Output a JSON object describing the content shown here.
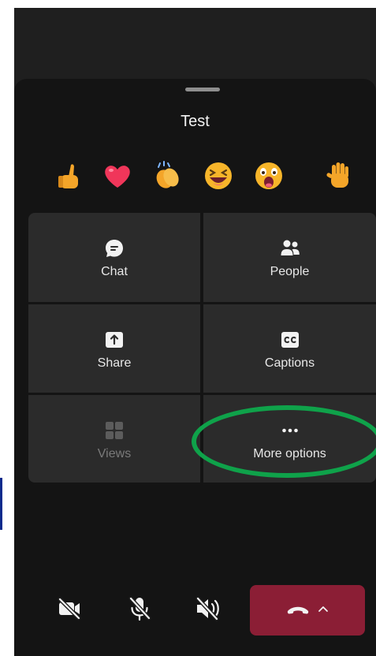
{
  "meeting": {
    "title": "Test"
  },
  "reactions": [
    {
      "icon": "thumbs-up-icon"
    },
    {
      "icon": "heart-icon"
    },
    {
      "icon": "clapping-hands-icon"
    },
    {
      "icon": "laughing-face-icon"
    },
    {
      "icon": "surprised-face-icon"
    },
    {
      "icon": "raised-hand-icon"
    }
  ],
  "grid": {
    "chat": {
      "label": "Chat",
      "icon": "chat-icon"
    },
    "people": {
      "label": "People",
      "icon": "people-icon"
    },
    "share": {
      "label": "Share",
      "icon": "share-icon"
    },
    "captions": {
      "label": "Captions",
      "icon": "captions-icon"
    },
    "views": {
      "label": "Views",
      "icon": "views-icon",
      "disabled": true
    },
    "more": {
      "label": "More options",
      "icon": "more-options-icon"
    }
  },
  "controls": {
    "camera": {
      "icon": "camera-off-icon"
    },
    "mic": {
      "icon": "mic-off-icon"
    },
    "speaker": {
      "icon": "speaker-off-icon"
    },
    "end_call": {
      "icon": "end-call-icon",
      "color": "#8b1e35"
    }
  },
  "annotation": {
    "color": "#0fa24a"
  }
}
